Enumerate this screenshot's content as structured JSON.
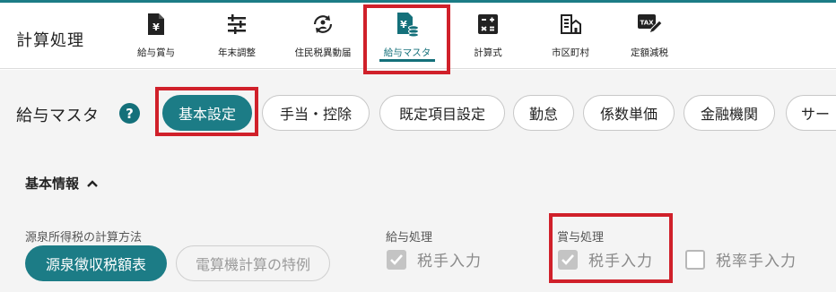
{
  "app": {
    "title": "計算処理"
  },
  "nav": [
    {
      "label": "給与賞与",
      "icon": "yen-document-icon"
    },
    {
      "label": "年末調整",
      "icon": "sliders-icon"
    },
    {
      "label": "住民税異動届",
      "icon": "person-refresh-icon"
    },
    {
      "label": "給与マスタ",
      "icon": "document-coins-icon",
      "active": true
    },
    {
      "label": "計算式",
      "icon": "calculator-icon"
    },
    {
      "label": "市区町村",
      "icon": "building-icon"
    },
    {
      "label": "定額減税",
      "icon": "tax-edit-icon"
    }
  ],
  "page": {
    "title": "給与マスタ",
    "help": "?",
    "tabs": [
      {
        "label": "基本設定",
        "active": true
      },
      {
        "label": "手当・控除"
      },
      {
        "label": "既定項目設定"
      },
      {
        "label": "勤怠"
      },
      {
        "label": "係数単価"
      },
      {
        "label": "金融機関"
      },
      {
        "label": "サー"
      }
    ]
  },
  "basic_info": {
    "title": "基本情報",
    "withholding": {
      "label": "源泉所得税の計算方法",
      "options": [
        {
          "label": "源泉徴収税額表",
          "selected": true
        },
        {
          "label": "電算機計算の特例",
          "selected": false
        }
      ]
    },
    "salary": {
      "label": "給与処理",
      "checks": [
        {
          "label": "税手入力",
          "checked": true
        }
      ]
    },
    "bonus": {
      "label": "賞与処理",
      "checks": [
        {
          "label": "税手入力",
          "checked": true
        },
        {
          "label": "税率手入力",
          "checked": false
        }
      ]
    }
  },
  "colors": {
    "accent": "#1c7c86",
    "highlight": "#d0202a"
  }
}
